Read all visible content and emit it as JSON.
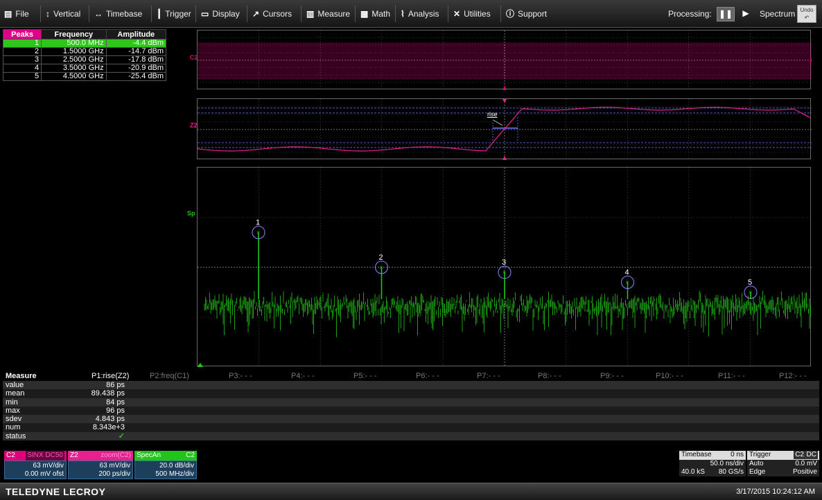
{
  "menu": {
    "file": "File",
    "vertical": "Vertical",
    "timebase": "Timebase",
    "trigger": "Trigger",
    "display": "Display",
    "cursors": "Cursors",
    "measure": "Measure",
    "math": "Math",
    "analysis": "Analysis",
    "utilities": "Utilities",
    "support": "Support"
  },
  "toolbar": {
    "processing": "Processing:",
    "pause": "❚❚",
    "play": "▶",
    "spectrum": "Spectrum",
    "undo": "Undo"
  },
  "peaks": {
    "headers": [
      "Peaks",
      "Frequency",
      "Amplitude"
    ],
    "rows": [
      {
        "n": "1",
        "freq": "500.0 MHz",
        "amp": "-4.4 dBm",
        "selected": true
      },
      {
        "n": "2",
        "freq": "1.5000 GHz",
        "amp": "-14.7 dBm",
        "selected": false
      },
      {
        "n": "3",
        "freq": "2.5000 GHz",
        "amp": "-17.8 dBm",
        "selected": false
      },
      {
        "n": "4",
        "freq": "3.5000 GHz",
        "amp": "-20.9 dBm",
        "selected": false
      },
      {
        "n": "5",
        "freq": "4.5000 GHz",
        "amp": "-25.4 dBm",
        "selected": false
      }
    ]
  },
  "traces": {
    "c2_label": "C2",
    "z2_label": "Z2",
    "sp_label": "Sp",
    "rise_label": "rise",
    "peak_markers": [
      "1",
      "2",
      "3",
      "4",
      "5"
    ],
    "peak_levels_div": [
      2.7,
      2.0,
      1.9,
      1.7,
      1.5
    ]
  },
  "measure": {
    "title": "Measure",
    "params": [
      "P1:rise(Z2)",
      "P2:freq(C1)",
      "P3:- - -",
      "P4:- - -",
      "P5:- - -",
      "P6:- - -",
      "P7:- - -",
      "P8:- - -",
      "P9:- - -",
      "P10:- - -",
      "P11:- - -",
      "P12:- - -"
    ],
    "rows": [
      {
        "label": "value",
        "value": "86 ps"
      },
      {
        "label": "mean",
        "value": "89.438 ps"
      },
      {
        "label": "min",
        "value": "84 ps"
      },
      {
        "label": "max",
        "value": "96 ps"
      },
      {
        "label": "sdev",
        "value": "4.843 ps"
      },
      {
        "label": "num",
        "value": "8.343e+3"
      },
      {
        "label": "status",
        "value": "✓"
      }
    ]
  },
  "channels": {
    "c2": {
      "name": "C2",
      "tags": "SINX DC50",
      "vdiv": "63 mV/div",
      "offset": "0.00 mV ofst"
    },
    "z2": {
      "name": "Z2",
      "src": "zoom(C2)",
      "vdiv": "63 mV/div",
      "tdiv": "200 ps/div"
    },
    "specan": {
      "name": "SpecAn",
      "src": "C2",
      "ydiv": "20.0 dB/div",
      "fdiv": "500 MHz/div"
    }
  },
  "timebase": {
    "title": "Timebase",
    "delay": "0 ns",
    "tdiv": "50.0 ns/div",
    "samples": "40.0 kS",
    "rate": "80 GS/s"
  },
  "trigger": {
    "title": "Trigger",
    "src": "C2",
    "coupling": "DC",
    "mode": "Auto",
    "level": "0.0 mV",
    "type": "Edge",
    "slope": "Positive"
  },
  "footer": {
    "brand": "TELEDYNE LECROY",
    "datetime": "3/17/2015 10:24:12 AM"
  },
  "colors": {
    "c2": "#e0007a",
    "z2": "#e8208e",
    "spectrum": "#22c41a",
    "grid": "#666666",
    "accent_blue": "#6a7bff"
  }
}
